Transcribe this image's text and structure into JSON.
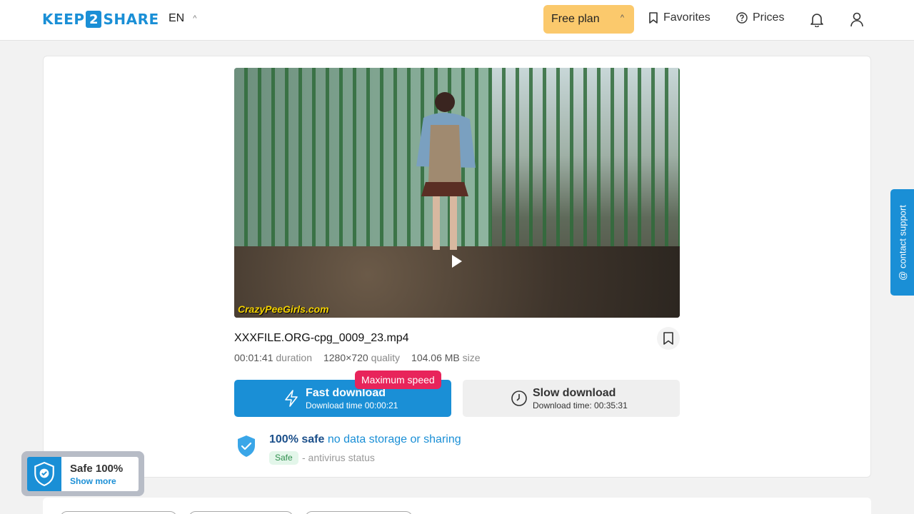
{
  "header": {
    "logo_left": "KEEP",
    "logo_num": "2",
    "logo_right": "SHARE",
    "language": "EN",
    "plan_label": "Free plan",
    "favorites_label": "Favorites",
    "prices_label": "Prices"
  },
  "file": {
    "name": "XXXFILE.ORG-cpg_0009_23.mp4",
    "duration_value": "00:01:41",
    "duration_label": "duration",
    "quality_value": "1280×720",
    "quality_label": "quality",
    "size_value": "104.06 MB",
    "size_label": "size",
    "watermark": "CrazyPeeGirls.com"
  },
  "download": {
    "badge": "Maximum speed",
    "fast_title": "Fast download",
    "fast_sub": "Download time 00:00:21",
    "slow_title": "Slow download",
    "slow_sub": "Download time: 00:35:31"
  },
  "safety": {
    "bold": "100% safe",
    "rest": "no data storage or sharing",
    "tag": "Safe",
    "status": "- antivirus status"
  },
  "support_label": "@ contact support",
  "widget": {
    "title": "Safe 100%",
    "link": "Show more"
  },
  "colors": {
    "accent": "#1a8fd6",
    "plan": "#fbc96c",
    "badge": "#e8245b"
  }
}
